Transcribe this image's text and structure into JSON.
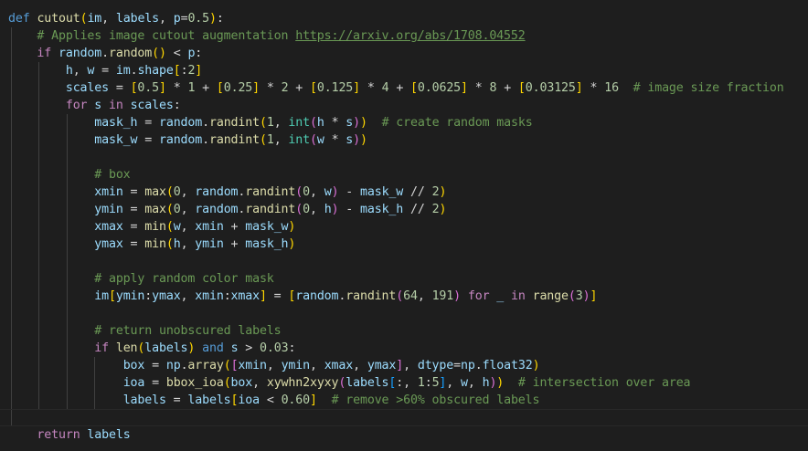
{
  "editor": {
    "theme_colors": {
      "background": "#1e1e1e",
      "keyword_control": "#c586c0",
      "keyword": "#569cd6",
      "function": "#dcdcaa",
      "variable": "#9cdcfe",
      "number": "#b5cea8",
      "comment": "#6a9955",
      "builtin": "#4ec9b0",
      "bracket_1": "#ffd700",
      "bracket_2": "#da70d6",
      "bracket_3": "#179fff"
    },
    "lines": [
      [
        [
          "def",
          "def"
        ],
        [
          "op",
          " "
        ],
        [
          "fn",
          "cutout"
        ],
        [
          "br1",
          "("
        ],
        [
          "var",
          "im"
        ],
        [
          "op",
          ", "
        ],
        [
          "var",
          "labels"
        ],
        [
          "op",
          ", "
        ],
        [
          "var",
          "p"
        ],
        [
          "op",
          "="
        ],
        [
          "num",
          "0.5"
        ],
        [
          "br1",
          ")"
        ],
        [
          "op",
          ":"
        ]
      ],
      [
        [
          "op",
          "    "
        ],
        [
          "cmt",
          "# Applies image cutout augmentation "
        ],
        [
          "link",
          "https://arxiv.org/abs/1708.04552"
        ]
      ],
      [
        [
          "op",
          "    "
        ],
        [
          "kw",
          "if"
        ],
        [
          "op",
          " "
        ],
        [
          "var",
          "random"
        ],
        [
          "op",
          "."
        ],
        [
          "fn",
          "random"
        ],
        [
          "br1",
          "()"
        ],
        [
          "op",
          " < "
        ],
        [
          "var",
          "p"
        ],
        [
          "op",
          ":"
        ]
      ],
      [
        [
          "op",
          "        "
        ],
        [
          "var",
          "h"
        ],
        [
          "op",
          ", "
        ],
        [
          "var",
          "w"
        ],
        [
          "op",
          " = "
        ],
        [
          "var",
          "im"
        ],
        [
          "op",
          "."
        ],
        [
          "var",
          "shape"
        ],
        [
          "br1",
          "["
        ],
        [
          "op",
          ":"
        ],
        [
          "num",
          "2"
        ],
        [
          "br1",
          "]"
        ]
      ],
      [
        [
          "op",
          "        "
        ],
        [
          "var",
          "scales"
        ],
        [
          "op",
          " = "
        ],
        [
          "br1",
          "["
        ],
        [
          "num",
          "0.5"
        ],
        [
          "br1",
          "]"
        ],
        [
          "op",
          " * "
        ],
        [
          "num",
          "1"
        ],
        [
          "op",
          " + "
        ],
        [
          "br1",
          "["
        ],
        [
          "num",
          "0.25"
        ],
        [
          "br1",
          "]"
        ],
        [
          "op",
          " * "
        ],
        [
          "num",
          "2"
        ],
        [
          "op",
          " + "
        ],
        [
          "br1",
          "["
        ],
        [
          "num",
          "0.125"
        ],
        [
          "br1",
          "]"
        ],
        [
          "op",
          " * "
        ],
        [
          "num",
          "4"
        ],
        [
          "op",
          " + "
        ],
        [
          "br1",
          "["
        ],
        [
          "num",
          "0.0625"
        ],
        [
          "br1",
          "]"
        ],
        [
          "op",
          " * "
        ],
        [
          "num",
          "8"
        ],
        [
          "op",
          " + "
        ],
        [
          "br1",
          "["
        ],
        [
          "num",
          "0.03125"
        ],
        [
          "br1",
          "]"
        ],
        [
          "op",
          " * "
        ],
        [
          "num",
          "16"
        ],
        [
          "op",
          "  "
        ],
        [
          "cmt",
          "# image size fraction"
        ]
      ],
      [
        [
          "op",
          "        "
        ],
        [
          "kw",
          "for"
        ],
        [
          "op",
          " "
        ],
        [
          "var",
          "s"
        ],
        [
          "op",
          " "
        ],
        [
          "kw",
          "in"
        ],
        [
          "op",
          " "
        ],
        [
          "var",
          "scales"
        ],
        [
          "op",
          ":"
        ]
      ],
      [
        [
          "op",
          "            "
        ],
        [
          "var",
          "mask_h"
        ],
        [
          "op",
          " = "
        ],
        [
          "var",
          "random"
        ],
        [
          "op",
          "."
        ],
        [
          "fn",
          "randint"
        ],
        [
          "br1",
          "("
        ],
        [
          "num",
          "1"
        ],
        [
          "op",
          ", "
        ],
        [
          "bi",
          "int"
        ],
        [
          "br2",
          "("
        ],
        [
          "var",
          "h"
        ],
        [
          "op",
          " * "
        ],
        [
          "var",
          "s"
        ],
        [
          "br2",
          ")"
        ],
        [
          "br1",
          ")"
        ],
        [
          "op",
          "  "
        ],
        [
          "cmt",
          "# create random masks"
        ]
      ],
      [
        [
          "op",
          "            "
        ],
        [
          "var",
          "mask_w"
        ],
        [
          "op",
          " = "
        ],
        [
          "var",
          "random"
        ],
        [
          "op",
          "."
        ],
        [
          "fn",
          "randint"
        ],
        [
          "br1",
          "("
        ],
        [
          "num",
          "1"
        ],
        [
          "op",
          ", "
        ],
        [
          "bi",
          "int"
        ],
        [
          "br2",
          "("
        ],
        [
          "var",
          "w"
        ],
        [
          "op",
          " * "
        ],
        [
          "var",
          "s"
        ],
        [
          "br2",
          ")"
        ],
        [
          "br1",
          ")"
        ]
      ],
      [],
      [
        [
          "op",
          "            "
        ],
        [
          "cmt",
          "# box"
        ]
      ],
      [
        [
          "op",
          "            "
        ],
        [
          "var",
          "xmin"
        ],
        [
          "op",
          " = "
        ],
        [
          "fn",
          "max"
        ],
        [
          "br1",
          "("
        ],
        [
          "num",
          "0"
        ],
        [
          "op",
          ", "
        ],
        [
          "var",
          "random"
        ],
        [
          "op",
          "."
        ],
        [
          "fn",
          "randint"
        ],
        [
          "br2",
          "("
        ],
        [
          "num",
          "0"
        ],
        [
          "op",
          ", "
        ],
        [
          "var",
          "w"
        ],
        [
          "br2",
          ")"
        ],
        [
          "op",
          " - "
        ],
        [
          "var",
          "mask_w"
        ],
        [
          "op",
          " // "
        ],
        [
          "num",
          "2"
        ],
        [
          "br1",
          ")"
        ]
      ],
      [
        [
          "op",
          "            "
        ],
        [
          "var",
          "ymin"
        ],
        [
          "op",
          " = "
        ],
        [
          "fn",
          "max"
        ],
        [
          "br1",
          "("
        ],
        [
          "num",
          "0"
        ],
        [
          "op",
          ", "
        ],
        [
          "var",
          "random"
        ],
        [
          "op",
          "."
        ],
        [
          "fn",
          "randint"
        ],
        [
          "br2",
          "("
        ],
        [
          "num",
          "0"
        ],
        [
          "op",
          ", "
        ],
        [
          "var",
          "h"
        ],
        [
          "br2",
          ")"
        ],
        [
          "op",
          " - "
        ],
        [
          "var",
          "mask_h"
        ],
        [
          "op",
          " // "
        ],
        [
          "num",
          "2"
        ],
        [
          "br1",
          ")"
        ]
      ],
      [
        [
          "op",
          "            "
        ],
        [
          "var",
          "xmax"
        ],
        [
          "op",
          " = "
        ],
        [
          "fn",
          "min"
        ],
        [
          "br1",
          "("
        ],
        [
          "var",
          "w"
        ],
        [
          "op",
          ", "
        ],
        [
          "var",
          "xmin"
        ],
        [
          "op",
          " + "
        ],
        [
          "var",
          "mask_w"
        ],
        [
          "br1",
          ")"
        ]
      ],
      [
        [
          "op",
          "            "
        ],
        [
          "var",
          "ymax"
        ],
        [
          "op",
          " = "
        ],
        [
          "fn",
          "min"
        ],
        [
          "br1",
          "("
        ],
        [
          "var",
          "h"
        ],
        [
          "op",
          ", "
        ],
        [
          "var",
          "ymin"
        ],
        [
          "op",
          " + "
        ],
        [
          "var",
          "mask_h"
        ],
        [
          "br1",
          ")"
        ]
      ],
      [],
      [
        [
          "op",
          "            "
        ],
        [
          "cmt",
          "# apply random color mask"
        ]
      ],
      [
        [
          "op",
          "            "
        ],
        [
          "var",
          "im"
        ],
        [
          "br1",
          "["
        ],
        [
          "var",
          "ymin"
        ],
        [
          "op",
          ":"
        ],
        [
          "var",
          "ymax"
        ],
        [
          "op",
          ", "
        ],
        [
          "var",
          "xmin"
        ],
        [
          "op",
          ":"
        ],
        [
          "var",
          "xmax"
        ],
        [
          "br1",
          "]"
        ],
        [
          "op",
          " = "
        ],
        [
          "br1",
          "["
        ],
        [
          "var",
          "random"
        ],
        [
          "op",
          "."
        ],
        [
          "fn",
          "randint"
        ],
        [
          "br2",
          "("
        ],
        [
          "num",
          "64"
        ],
        [
          "op",
          ", "
        ],
        [
          "num",
          "191"
        ],
        [
          "br2",
          ")"
        ],
        [
          "op",
          " "
        ],
        [
          "kw",
          "for"
        ],
        [
          "op",
          " "
        ],
        [
          "var",
          "_"
        ],
        [
          "op",
          " "
        ],
        [
          "kw",
          "in"
        ],
        [
          "op",
          " "
        ],
        [
          "fn",
          "range"
        ],
        [
          "br2",
          "("
        ],
        [
          "num",
          "3"
        ],
        [
          "br2",
          ")"
        ],
        [
          "br1",
          "]"
        ]
      ],
      [],
      [
        [
          "op",
          "            "
        ],
        [
          "cmt",
          "# return unobscured labels"
        ]
      ],
      [
        [
          "op",
          "            "
        ],
        [
          "kw",
          "if"
        ],
        [
          "op",
          " "
        ],
        [
          "fn",
          "len"
        ],
        [
          "br1",
          "("
        ],
        [
          "var",
          "labels"
        ],
        [
          "br1",
          ")"
        ],
        [
          "op",
          " "
        ],
        [
          "def",
          "and"
        ],
        [
          "op",
          " "
        ],
        [
          "var",
          "s"
        ],
        [
          "op",
          " > "
        ],
        [
          "num",
          "0.03"
        ],
        [
          "op",
          ":"
        ]
      ],
      [
        [
          "op",
          "                "
        ],
        [
          "var",
          "box"
        ],
        [
          "op",
          " = "
        ],
        [
          "var",
          "np"
        ],
        [
          "op",
          "."
        ],
        [
          "fn",
          "array"
        ],
        [
          "br1",
          "("
        ],
        [
          "br2",
          "["
        ],
        [
          "var",
          "xmin"
        ],
        [
          "op",
          ", "
        ],
        [
          "var",
          "ymin"
        ],
        [
          "op",
          ", "
        ],
        [
          "var",
          "xmax"
        ],
        [
          "op",
          ", "
        ],
        [
          "var",
          "ymax"
        ],
        [
          "br2",
          "]"
        ],
        [
          "op",
          ", "
        ],
        [
          "var",
          "dtype"
        ],
        [
          "op",
          "="
        ],
        [
          "var",
          "np"
        ],
        [
          "op",
          "."
        ],
        [
          "var",
          "float32"
        ],
        [
          "br1",
          ")"
        ]
      ],
      [
        [
          "op",
          "                "
        ],
        [
          "var",
          "ioa"
        ],
        [
          "op",
          " = "
        ],
        [
          "fn",
          "bbox_ioa"
        ],
        [
          "br1",
          "("
        ],
        [
          "var",
          "box"
        ],
        [
          "op",
          ", "
        ],
        [
          "fn",
          "xywhn2xyxy"
        ],
        [
          "br2",
          "("
        ],
        [
          "var",
          "labels"
        ],
        [
          "br3",
          "["
        ],
        [
          "op",
          ":, "
        ],
        [
          "num",
          "1"
        ],
        [
          "op",
          ":"
        ],
        [
          "num",
          "5"
        ],
        [
          "br3",
          "]"
        ],
        [
          "op",
          ", "
        ],
        [
          "var",
          "w"
        ],
        [
          "op",
          ", "
        ],
        [
          "var",
          "h"
        ],
        [
          "br2",
          ")"
        ],
        [
          "br1",
          ")"
        ],
        [
          "op",
          "  "
        ],
        [
          "cmt",
          "# intersection over area"
        ]
      ],
      [
        [
          "op",
          "                "
        ],
        [
          "var",
          "labels"
        ],
        [
          "op",
          " = "
        ],
        [
          "var",
          "labels"
        ],
        [
          "br1",
          "["
        ],
        [
          "var",
          "ioa"
        ],
        [
          "op",
          " < "
        ],
        [
          "num",
          "0.60"
        ],
        [
          "br1",
          "]"
        ],
        [
          "op",
          "  "
        ],
        [
          "cmt",
          "# remove >60% obscured labels"
        ]
      ],
      [],
      [
        [
          "op",
          "    "
        ],
        [
          "kw",
          "return"
        ],
        [
          "op",
          " "
        ],
        [
          "var",
          "labels"
        ]
      ]
    ],
    "guides": [
      [],
      [
        1
      ],
      [
        1
      ],
      [
        1,
        2
      ],
      [
        1,
        2
      ],
      [
        1,
        2
      ],
      [
        1,
        2,
        3
      ],
      [
        1,
        2,
        3
      ],
      [
        1,
        2,
        3
      ],
      [
        1,
        2,
        3
      ],
      [
        1,
        2,
        3
      ],
      [
        1,
        2,
        3
      ],
      [
        1,
        2,
        3
      ],
      [
        1,
        2,
        3
      ],
      [
        1,
        2,
        3
      ],
      [
        1,
        2,
        3
      ],
      [
        1,
        2,
        3
      ],
      [
        1,
        2,
        3
      ],
      [
        1,
        2,
        3
      ],
      [
        1,
        2,
        3
      ],
      [
        1,
        2,
        3,
        4
      ],
      [
        1,
        2,
        3,
        4
      ],
      [
        1,
        2,
        3,
        4
      ],
      [
        1
      ],
      []
    ],
    "current_line": 23
  }
}
